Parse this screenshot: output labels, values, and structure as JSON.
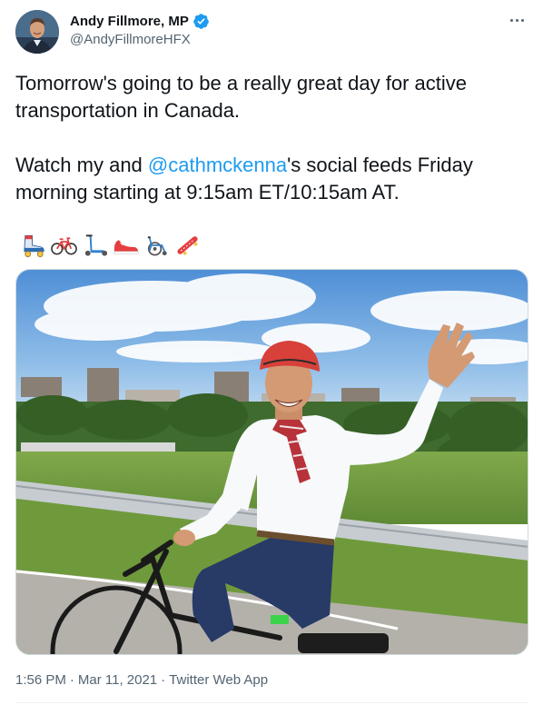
{
  "author": {
    "display_name": "Andy Fillmore, MP",
    "handle": "@AndyFillmoreHFX",
    "verified": true,
    "avatar_icon": "profile-avatar"
  },
  "tweet": {
    "line1": "Tomorrow's going to be a really great day for active transportation in Canada.",
    "line2_pre": "Watch my and ",
    "mention": "@cathmckenna",
    "line2_post": "'s social feeds Friday morning starting at 9:15am ET/10:15am AT.",
    "emojis": [
      "roller-skate-icon",
      "bicycle-icon",
      "kick-scooter-icon",
      "running-shoe-icon",
      "manual-wheelchair-icon",
      "skateboard-icon"
    ]
  },
  "media": {
    "type": "photo",
    "icon": "photo-man-waving-on-bicycle"
  },
  "footer": {
    "time": "1:56 PM",
    "date": "Mar 11, 2021",
    "source": "Twitter Web App",
    "separator": "·"
  },
  "colors": {
    "text": "#0f1419",
    "secondary": "#536471",
    "link": "#1d9bf0",
    "verified": "#1d9bf0"
  }
}
